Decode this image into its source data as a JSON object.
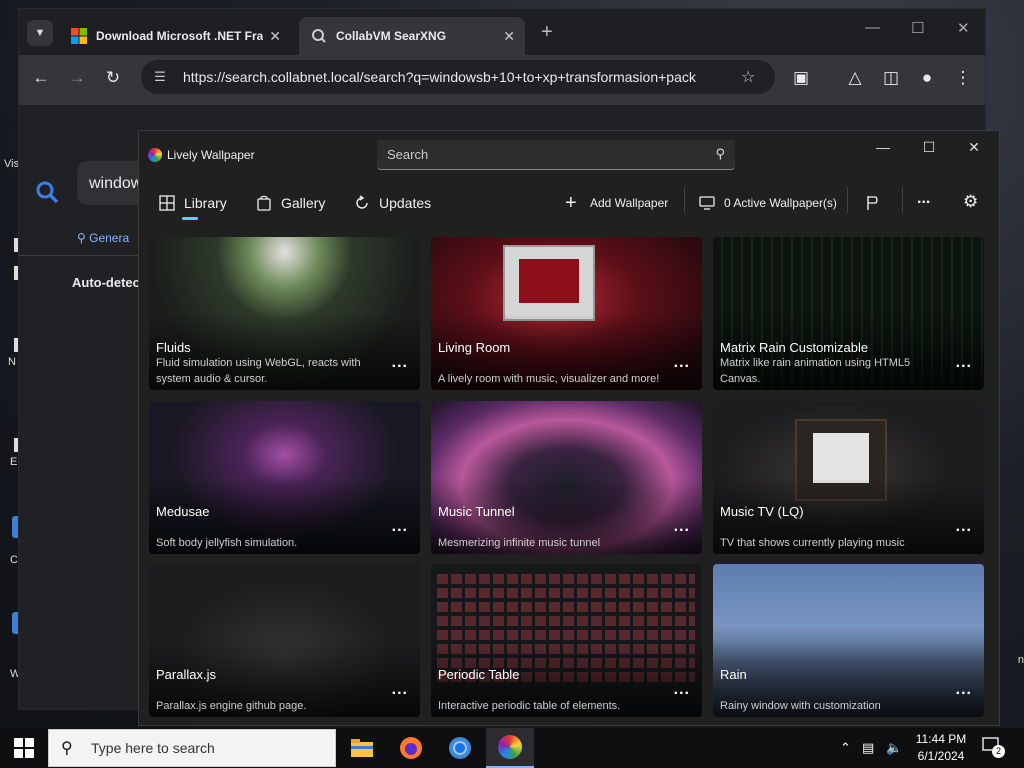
{
  "desktop": {
    "labels": [
      "Vis",
      "N",
      "E",
      "C",
      "W",
      "n"
    ]
  },
  "chrome": {
    "tabs": [
      {
        "title": "Download Microsoft .NET Fram"
      },
      {
        "title": "CollabVM SearXNG"
      }
    ],
    "url": "https://search.collabnet.local/search?q=windowsb+10+to+xp+transformasion+pack",
    "page": {
      "query": "window",
      "tab_general": "Genera",
      "auto_detect": "Auto-detect"
    }
  },
  "lively": {
    "title": "Lively Wallpaper",
    "search_placeholder": "Search",
    "nav": {
      "library": "Library",
      "gallery": "Gallery",
      "updates": "Updates",
      "add_wallpaper": "Add Wallpaper",
      "active_wallpapers": "0 Active Wallpaper(s)",
      "more": "..."
    },
    "cards": [
      {
        "title": "Fluids",
        "desc": "Fluid simulation using WebGL, reacts with system audio & cursor."
      },
      {
        "title": "Living Room",
        "desc": "A lively room with music, visualizer and more!"
      },
      {
        "title": "Matrix Rain Customizable",
        "desc": "Matrix like rain animation using HTML5 Canvas."
      },
      {
        "title": "Medusae",
        "desc": "Soft body jellyfish simulation."
      },
      {
        "title": "Music Tunnel",
        "desc": "Mesmerizing infinite music tunnel"
      },
      {
        "title": "Music TV (LQ)",
        "desc": "TV that shows currently playing music"
      },
      {
        "title": "Parallax.js",
        "desc": "Parallax.js engine github page."
      },
      {
        "title": "Periodic Table",
        "desc": "Interactive periodic table of elements."
      },
      {
        "title": "Rain",
        "desc": "Rainy window with customization"
      }
    ],
    "card_more": "..."
  },
  "taskbar": {
    "search_placeholder": "Type here to search",
    "time": "11:44 PM",
    "date": "6/1/2024",
    "notifications": "2"
  }
}
